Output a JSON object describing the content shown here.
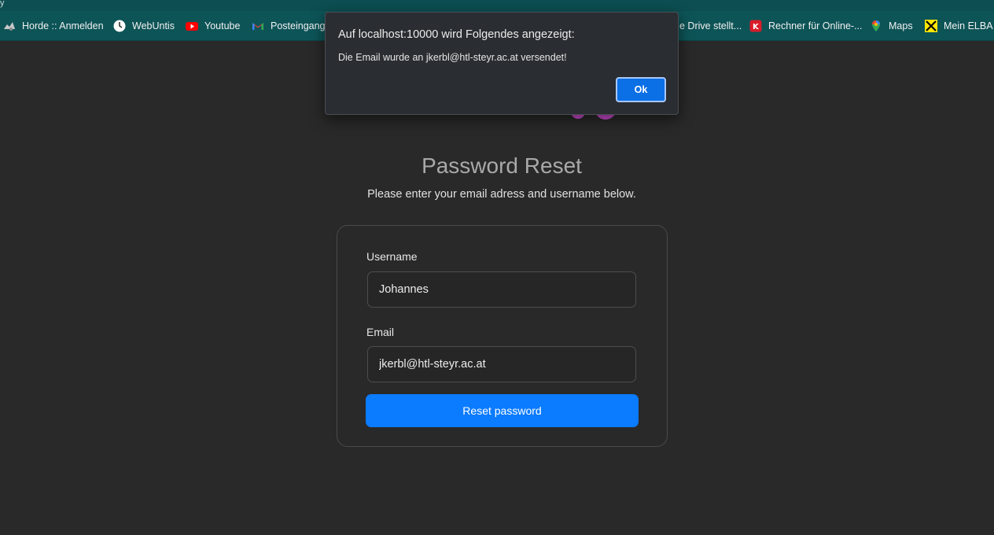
{
  "bookmarks": [
    {
      "label": "Horde :: Anmelden",
      "icon": "horde-icon"
    },
    {
      "label": "WebUntis",
      "icon": "webuntis-icon"
    },
    {
      "label": "Youtube",
      "icon": "youtube-icon"
    },
    {
      "label": "Posteingang",
      "icon": "gmail-icon"
    },
    {
      "label": "e Drive stellt...",
      "icon": "drive-icon"
    },
    {
      "label": "Rechner für Online-...",
      "icon": "rechner-icon"
    },
    {
      "label": "Maps",
      "icon": "maps-pin-icon"
    },
    {
      "label": "Mein ELBA",
      "icon": "elba-icon"
    }
  ],
  "top_sliver_glyph": "y",
  "page": {
    "title": "Password Reset",
    "subtitle": "Please enter your email adress and username below.",
    "username_label": "Username",
    "username_value": "Johannes",
    "email_label": "Email",
    "email_value": "jkerbl@htl-steyr.ac.at",
    "reset_button_label": "Reset password"
  },
  "dialog": {
    "title": "Auf localhost:10000 wird Folgendes angezeigt:",
    "message": "Die Email wurde an jkerbl@htl-steyr.ac.at versendet!",
    "ok_label": "Ok"
  },
  "colors": {
    "bookmarks_bar": "#0d5457",
    "page_background": "#292929",
    "primary_button": "#0b7bff",
    "dialog_background": "#2a2d31",
    "logo_magenta": "#d14fd6"
  }
}
